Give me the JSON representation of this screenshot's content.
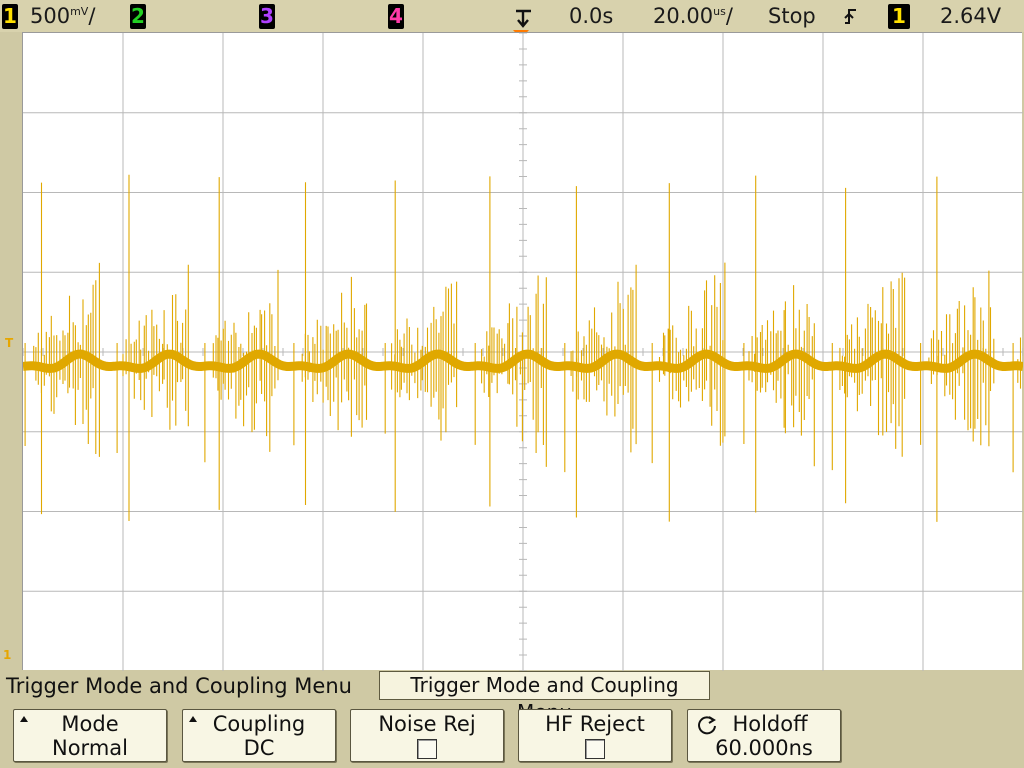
{
  "topbar": {
    "ch1_num": "1",
    "ch1_scale_num": "500",
    "ch1_scale_unit": "mV",
    "ch2_num": "2",
    "ch3_num": "3",
    "ch4_num": "4",
    "time_delay": "0.0s",
    "timebase_num": "20.00",
    "timebase_unit": "us",
    "run_state": "Stop",
    "trig_source": "1",
    "trig_level": "2.64V"
  },
  "screen": {
    "trig_level_marker": "T",
    "ground_marker": "1",
    "overlay_label": "Trigger Mode and Coupling Menu"
  },
  "menu": {
    "title": "Trigger Mode and Coupling Menu",
    "softkeys": [
      {
        "line1": "Mode",
        "line2": "Normal"
      },
      {
        "line1": "Coupling",
        "line2": "DC"
      },
      {
        "line1": "Noise Rej"
      },
      {
        "line1": "HF Reject"
      },
      {
        "line1": "Holdoff",
        "line2": "60.000ns"
      }
    ]
  },
  "colors": {
    "trace": "#e0a800",
    "grid": "#b8b8b8",
    "bezel": "#cfc9a4"
  }
}
